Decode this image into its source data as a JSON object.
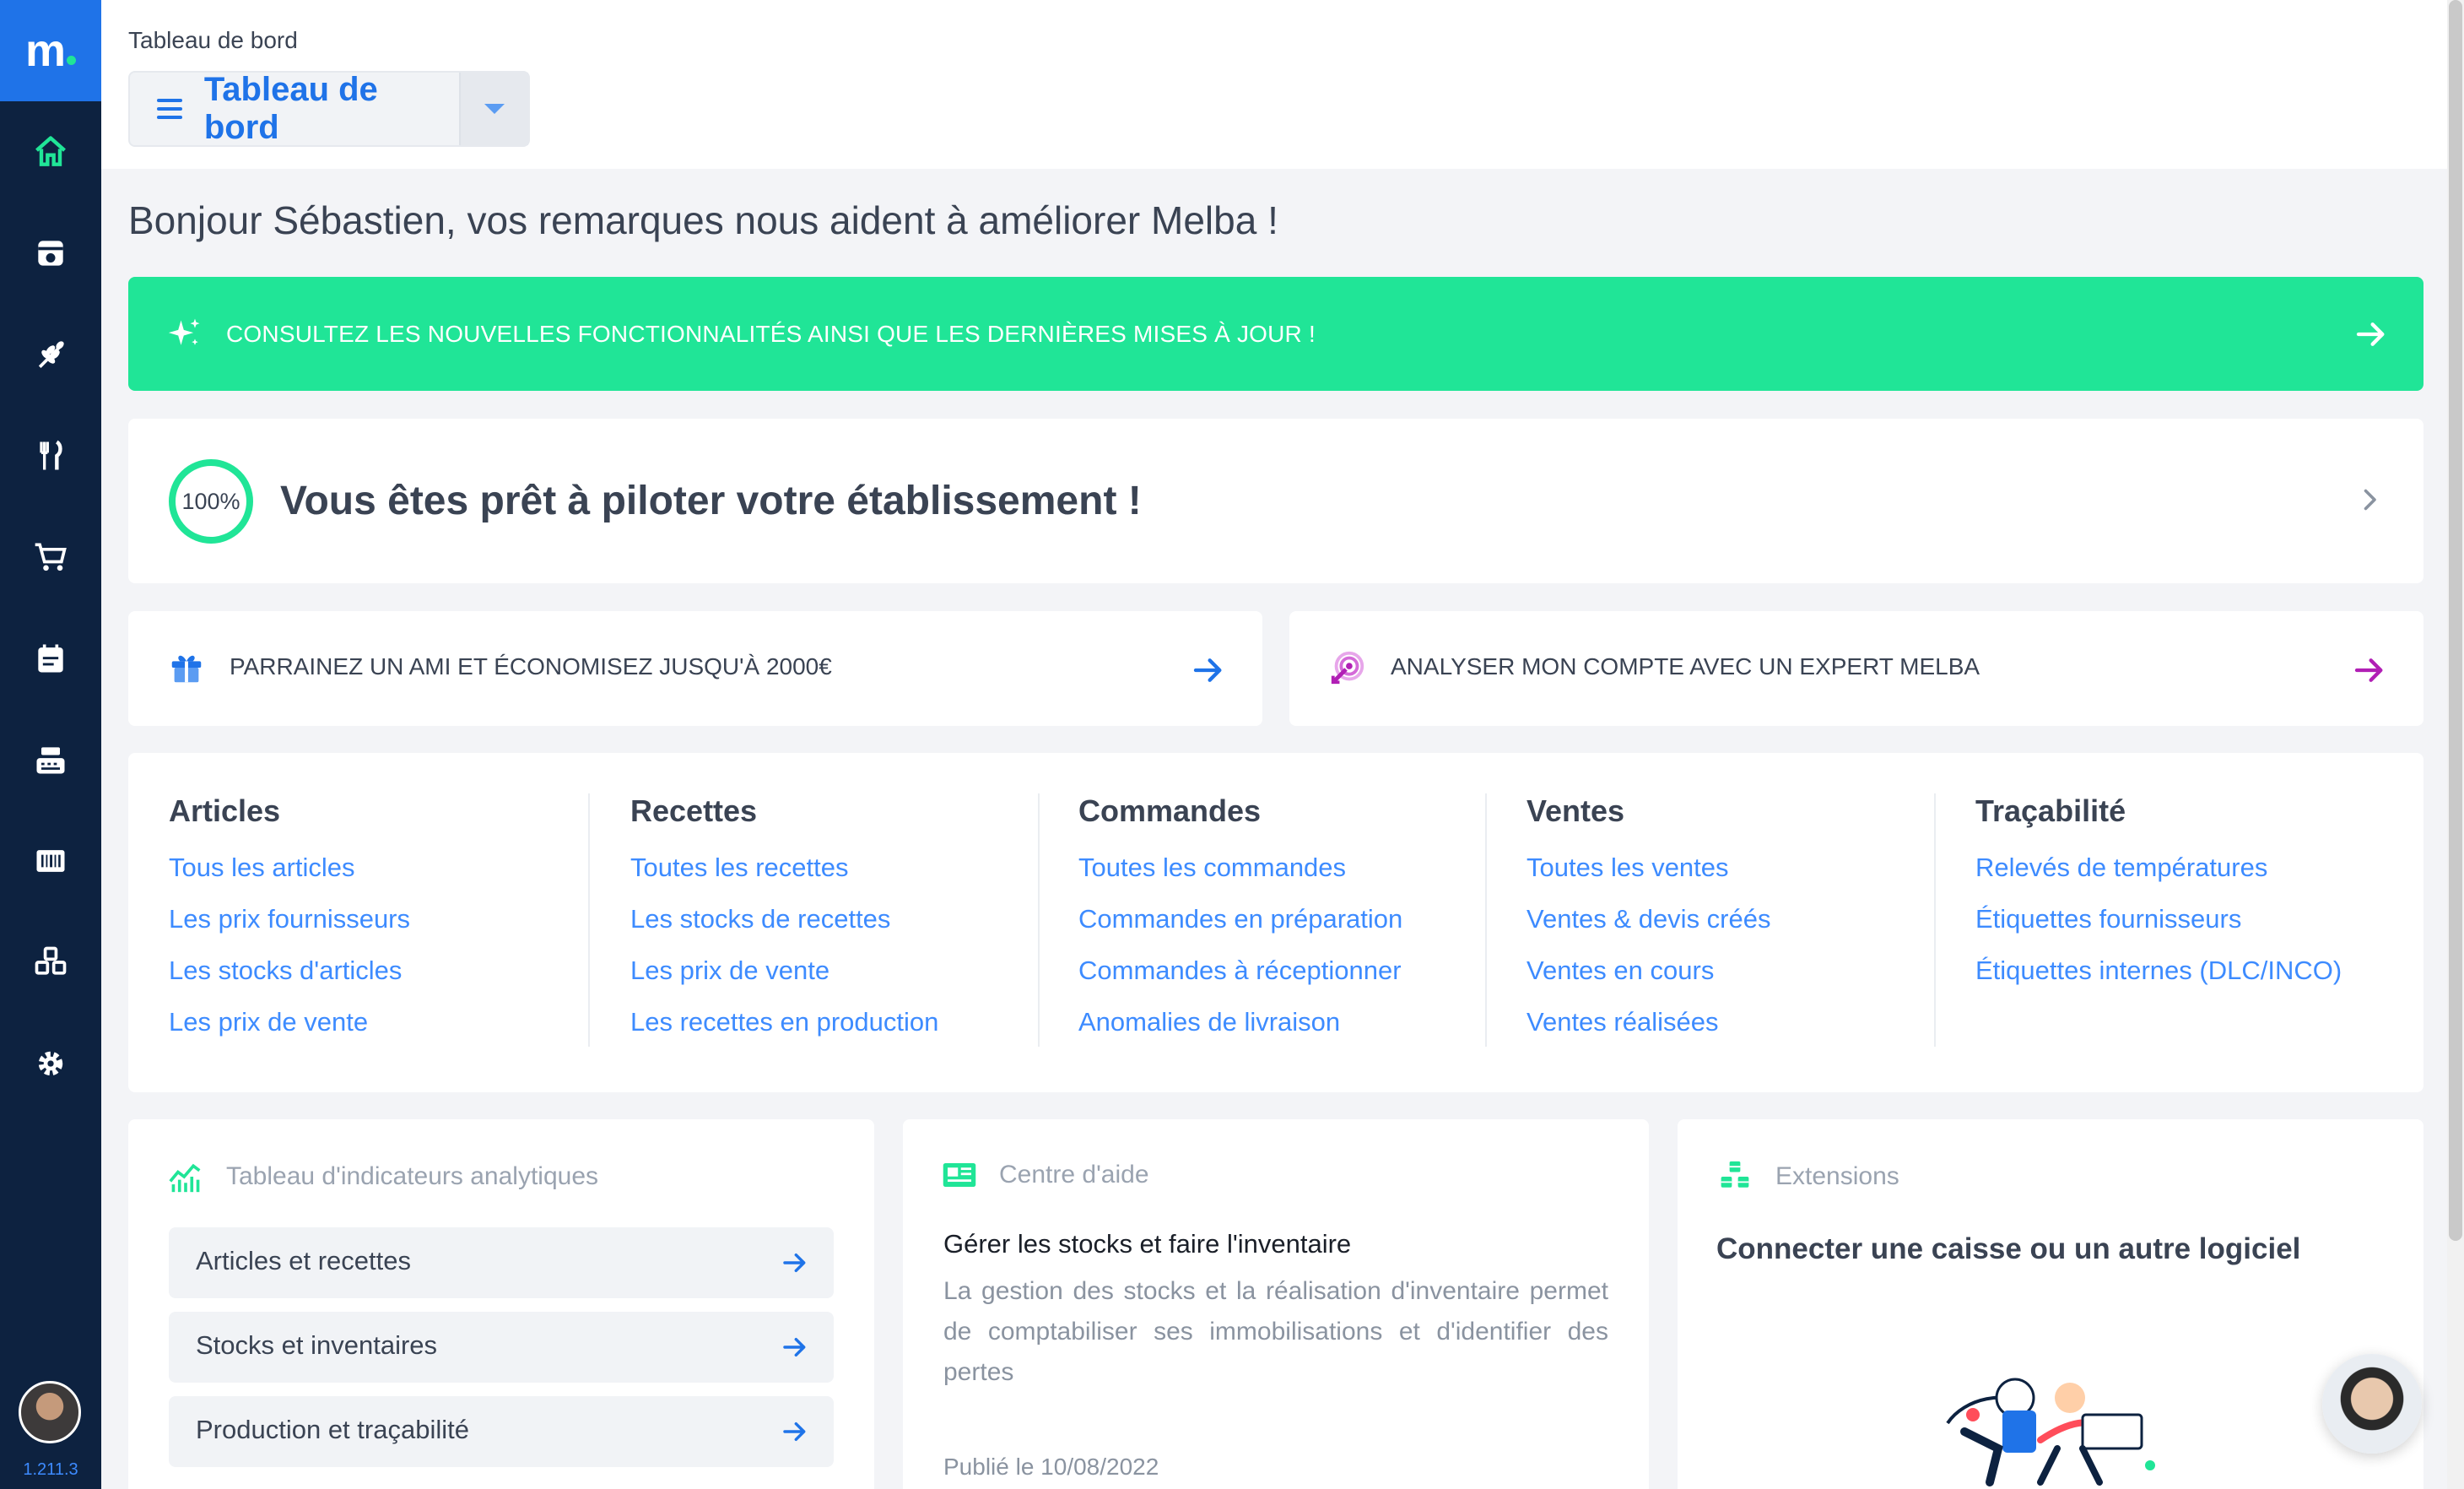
{
  "app": {
    "logo_letter": "m",
    "version": "1.211.3",
    "brand_color": "#1f73e8",
    "accent_color": "#20e597"
  },
  "sidebar": {
    "items": [
      {
        "icon": "home-icon",
        "active": true
      },
      {
        "icon": "inventory-icon"
      },
      {
        "icon": "wheat-icon"
      },
      {
        "icon": "fork-knife-icon"
      },
      {
        "icon": "cart-icon"
      },
      {
        "icon": "calendar-icon"
      },
      {
        "icon": "cash-register-icon"
      },
      {
        "icon": "barcode-icon"
      },
      {
        "icon": "cubes-icon"
      },
      {
        "icon": "gear-icon"
      }
    ]
  },
  "header": {
    "breadcrumb": "Tableau de bord",
    "title": "Tableau de bord"
  },
  "greeting": "Bonjour Sébastien, vos remarques nous aident à améliorer Melba !",
  "banner": {
    "text": "CONSULTEZ LES NOUVELLES FONCTIONNALITÉS AINSI QUE LES DERNIÈRES MISES À JOUR !"
  },
  "onboarding": {
    "progress": "100%",
    "progress_fraction": 1.0,
    "text": "Vous êtes prêt à piloter votre établissement !"
  },
  "promos": [
    {
      "text": "PARRAINEZ UN AMI ET ÉCONOMISEZ JUSQU'À 2000€",
      "icon": "gift-icon",
      "color": "#1f73e8"
    },
    {
      "text": "ANALYSER MON COMPTE AVEC UN EXPERT MELBA",
      "icon": "target-icon",
      "color": "#b11fb5"
    }
  ],
  "quick_links": [
    {
      "title": "Articles",
      "links": [
        "Tous les articles",
        "Les prix fournisseurs",
        "Les stocks d'articles",
        "Les prix de vente"
      ]
    },
    {
      "title": "Recettes",
      "links": [
        "Toutes les recettes",
        "Les stocks de recettes",
        "Les prix de vente",
        "Les recettes en production"
      ]
    },
    {
      "title": "Commandes",
      "links": [
        "Toutes les commandes",
        "Commandes en préparation",
        "Commandes à réceptionner",
        "Anomalies de livraison"
      ]
    },
    {
      "title": "Ventes",
      "links": [
        "Toutes les ventes",
        "Ventes & devis créés",
        "Ventes en cours",
        "Ventes réalisées"
      ]
    },
    {
      "title": "Traçabilité",
      "links": [
        "Relevés de températures",
        "Étiquettes fournisseurs",
        "Étiquettes internes (DLC/INCO)"
      ]
    }
  ],
  "analytics": {
    "title": "Tableau d'indicateurs analytiques",
    "items": [
      "Articles et recettes",
      "Stocks et inventaires",
      "Production et traçabilité"
    ]
  },
  "help": {
    "title": "Centre d'aide",
    "article_title": "Gérer les stocks et faire l'inventaire",
    "article_desc": "La gestion des stocks et la réalisation d'inventaire permet de comptabiliser ses immobilisations et d'identifier des pertes",
    "published": "Publié le 10/08/2022"
  },
  "extensions": {
    "title": "Extensions",
    "subtitle": "Connecter une caisse ou un autre logiciel"
  }
}
